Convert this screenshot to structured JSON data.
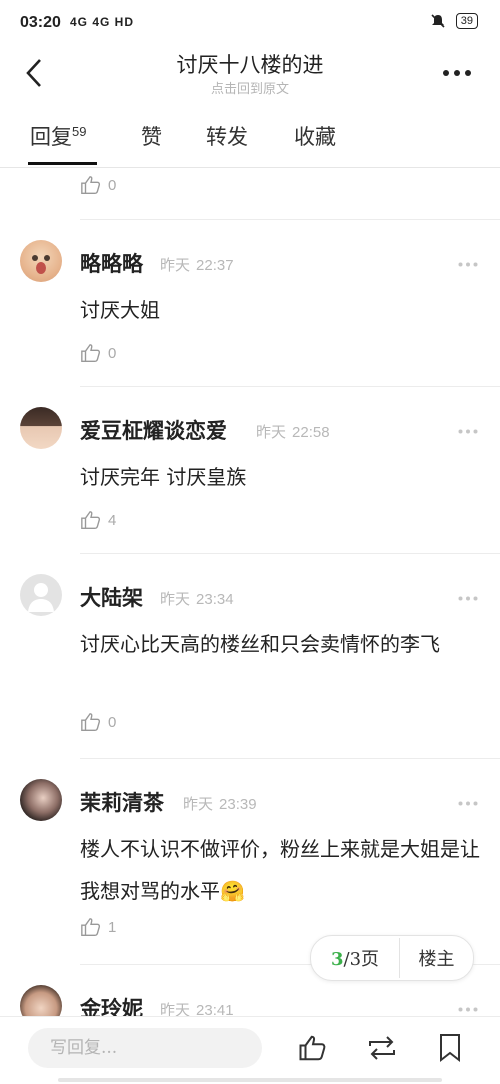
{
  "status_bar": {
    "time": "03:20",
    "network": "4G 4G HD",
    "battery": "39"
  },
  "header": {
    "title": "讨厌十八楼的进",
    "subtitle": "点击回到原文"
  },
  "tabs": [
    {
      "label": "回复",
      "count": "59"
    },
    {
      "label": "赞"
    },
    {
      "label": "转发"
    },
    {
      "label": "收藏"
    }
  ],
  "prev_post": {
    "likes": "0"
  },
  "posts": [
    {
      "username": "略略略",
      "date": "昨天",
      "time": "22:37",
      "text": "讨厌大姐",
      "likes": "0"
    },
    {
      "username": "爱豆柾耀谈恋爱",
      "date": "昨天",
      "time": "22:58",
      "text": "讨厌完年 讨厌皇族",
      "likes": "4"
    },
    {
      "username": "大陆架",
      "date": "昨天",
      "time": "23:34",
      "text": "讨厌心比天高的楼丝和只会卖情怀的李飞",
      "likes": "0"
    },
    {
      "username": "茉莉清茶",
      "date": "昨天",
      "time": "23:39",
      "text": "楼人不认识不做评价，粉丝上来就是大姐是让我想对骂的水平🤗",
      "likes": "1"
    },
    {
      "username": "金玲妮",
      "date": "昨天",
      "time": "23:41"
    }
  ],
  "pager": {
    "current": "3",
    "total_label": "/3页",
    "owner_label": "楼主"
  },
  "bottom": {
    "reply_placeholder": "写回复..."
  },
  "colors": {
    "accent_green": "#3bb04a"
  }
}
